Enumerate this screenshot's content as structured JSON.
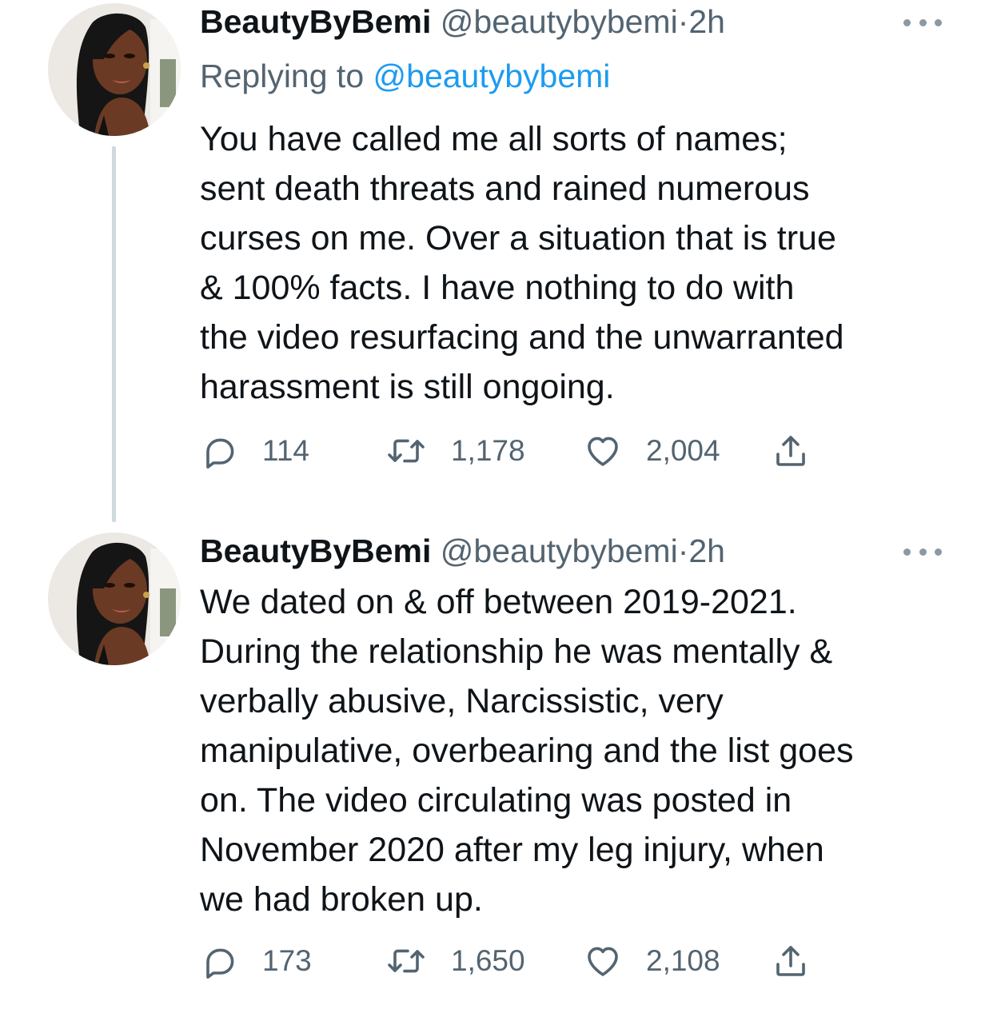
{
  "tweets": [
    {
      "display_name": "BeautyByBemi",
      "handle": "@beautybybemi",
      "separator": "·",
      "time": "2h",
      "replying_label": "Replying to",
      "replying_to": "@beautybybemi",
      "text": "You have called me all sorts of names;\nsent death threats and rained numerous\ncurses on me. Over a situation that is true\n& 100% facts. I have nothing to do with\nthe video resurfacing and the unwarranted\nharassment is still ongoing.",
      "replies": "114",
      "retweets": "1,178",
      "likes": "2,004"
    },
    {
      "display_name": "BeautyByBemi",
      "handle": "@beautybybemi",
      "separator": "·",
      "time": "2h",
      "text": "We dated on & off between 2019-2021.\nDuring the relationship he was mentally &\nverbally abusive, Narcissistic, very\nmanipulative, overbearing and the list goes\non. The video circulating was posted in\nNovember 2020 after my leg injury, when\nwe had broken up.",
      "replies": "173",
      "retweets": "1,650",
      "likes": "2,108"
    }
  ],
  "icons": {
    "reply": "reply-icon",
    "retweet": "retweet-icon",
    "like": "heart-icon",
    "share": "share-icon",
    "more": "more-icon"
  },
  "colors": {
    "text": "#0f1419",
    "secondary": "#536471",
    "link": "#1d9bf0",
    "thread_line": "#cfd9de"
  }
}
